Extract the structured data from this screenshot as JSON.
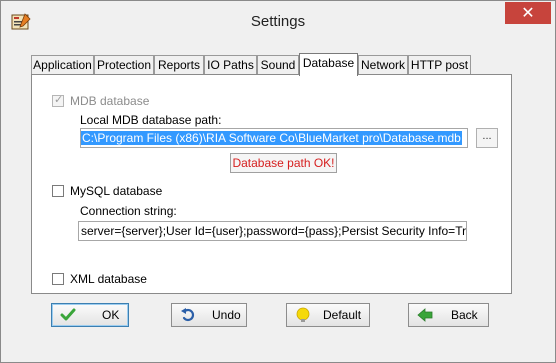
{
  "window": {
    "title": "Settings",
    "close_symbol": "✕"
  },
  "tabs": [
    {
      "label": "Application",
      "active": false
    },
    {
      "label": "Protection",
      "active": false
    },
    {
      "label": "Reports",
      "active": false
    },
    {
      "label": "IO Paths",
      "active": false
    },
    {
      "label": "Sound",
      "active": false
    },
    {
      "label": "Database",
      "active": true
    },
    {
      "label": "Network",
      "active": false
    },
    {
      "label": "HTTP post",
      "active": false
    }
  ],
  "mdb": {
    "checkbox_label": "MDB database",
    "checked": true,
    "enabled": false,
    "path_label": "Local MDB database path:",
    "path_value": "C:\\Program Files (x86)\\RIA Software Co\\BlueMarket pro\\Database.mdb",
    "browse_label": "...",
    "status_text": "Database path OK!"
  },
  "mysql": {
    "checkbox_label": "MySQL database",
    "checked": false,
    "connection_label": "Connection string:",
    "connection_value": "server={server};User Id={user};password={pass};Persist Security Info=True;databa"
  },
  "xml": {
    "checkbox_label": "XML database",
    "checked": false
  },
  "buttons": {
    "ok": "OK",
    "undo": "Undo",
    "default": "Default",
    "back": "Back"
  },
  "colors": {
    "close": "#c7443c",
    "selection": "#3399ff",
    "status_text": "#d62020",
    "ok_check": "#3aa53a",
    "back_arrow": "#3aa53a",
    "default_bulb": "#f5d90a"
  }
}
